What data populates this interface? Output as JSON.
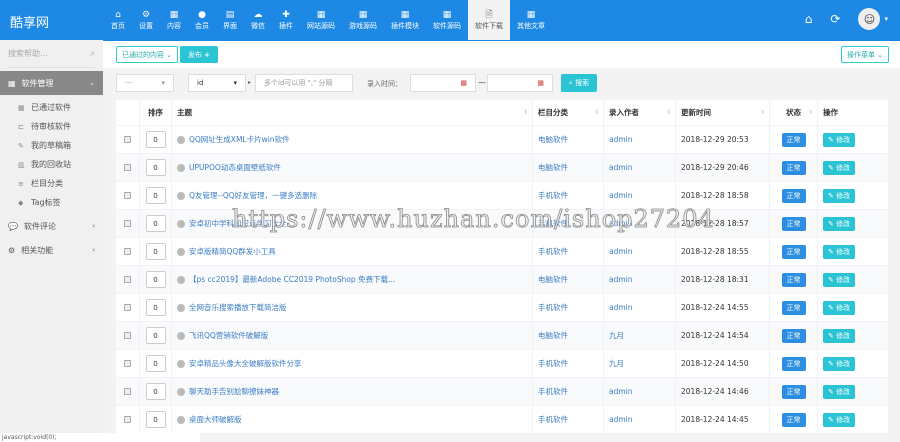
{
  "app": {
    "logo": "酷享网"
  },
  "nav": [
    {
      "label": "首页",
      "icon": "home-icon",
      "glyph": "⌂"
    },
    {
      "label": "设置",
      "icon": "gear-icon",
      "glyph": "⚙"
    },
    {
      "label": "内容",
      "icon": "grid-icon",
      "glyph": "▦"
    },
    {
      "label": "会员",
      "icon": "user-icon",
      "glyph": "●"
    },
    {
      "label": "界面",
      "icon": "layout-icon",
      "glyph": "▤"
    },
    {
      "label": "微信",
      "icon": "wechat-icon",
      "glyph": "☁"
    },
    {
      "label": "插件",
      "icon": "puzzle-icon",
      "glyph": "✚"
    },
    {
      "label": "网站源码",
      "icon": "table-icon",
      "glyph": "▦"
    },
    {
      "label": "游戏源码",
      "icon": "table-icon",
      "glyph": "▦"
    },
    {
      "label": "插件模块",
      "icon": "table-icon",
      "glyph": "▦"
    },
    {
      "label": "软件源码",
      "icon": "table-icon",
      "glyph": "▦"
    },
    {
      "label": "软件下载",
      "icon": "file-icon",
      "glyph": "🗎",
      "active": true
    },
    {
      "label": "其他文章",
      "icon": "table-icon",
      "glyph": "▦"
    }
  ],
  "sidebar": {
    "search_placeholder": "搜索帮助...",
    "group_main": "软件管理",
    "items": [
      {
        "label": "已通过软件",
        "icon": "grid-icon",
        "glyph": "▦"
      },
      {
        "label": "待审核软件",
        "icon": "ticket-icon",
        "glyph": "⊏"
      },
      {
        "label": "我的草稿箱",
        "icon": "edit-icon",
        "glyph": "✎"
      },
      {
        "label": "我的回收站",
        "icon": "trash-icon",
        "glyph": "▥"
      },
      {
        "label": "栏目分类",
        "icon": "list-icon",
        "glyph": "≡"
      },
      {
        "label": "Tag标签",
        "icon": "tag-icon",
        "glyph": "◆"
      }
    ],
    "group_comments": "软件评论",
    "group_related": "相关功能"
  },
  "toolbar": {
    "filter_dropdown": "已通过的内容",
    "publish": "发布",
    "batch": "操作菜单"
  },
  "search": {
    "select1": "---",
    "select2": "id",
    "ids_placeholder": "多个id可以用 \",\" 分隔",
    "time_label": "录入时间：",
    "dash": "—",
    "search_button": "搜索"
  },
  "table": {
    "headers": [
      "",
      "排序",
      "主题",
      "栏目分类",
      "录入作者",
      "更新时间",
      "状态",
      "操作"
    ],
    "status_label": "正常",
    "edit_label": "修改",
    "rows": [
      {
        "order": "0",
        "title": "QQ网址生成XML卡片win软件",
        "category": "电脑软件",
        "author": "admin",
        "time": "2018-12-29 20:53"
      },
      {
        "order": "0",
        "title": "UPUPOO动态桌面壁纸软件",
        "category": "电脑软件",
        "author": "admin",
        "time": "2018-12-29 20:46"
      },
      {
        "order": "0",
        "title": "Q友管理--QQ好友管理，一键多选删除",
        "category": "手机软件",
        "author": "admin",
        "time": "2018-12-28 18:58"
      },
      {
        "order": "0",
        "title": "安卓初中学科知识点学习大全",
        "category": "手机软件",
        "author": "admin",
        "time": "2018-12-28 18:57"
      },
      {
        "order": "0",
        "title": "安卓版精简QQ群发小工具",
        "category": "手机软件",
        "author": "admin",
        "time": "2018-12-28 18:55"
      },
      {
        "order": "0",
        "title": "【ps cc2019】最新Adobe CC2019 PhotoShop 免费下载...",
        "category": "电脑软件",
        "author": "admin",
        "time": "2018-12-28 18:31"
      },
      {
        "order": "0",
        "title": "全网音乐搜索播放下载简洁版",
        "category": "手机软件",
        "author": "admin",
        "time": "2018-12-24 14:55"
      },
      {
        "order": "0",
        "title": "飞讯QQ营销软件破解版",
        "category": "电脑软件",
        "author": "九月",
        "time": "2018-12-24 14:54"
      },
      {
        "order": "0",
        "title": "安卓精品头像大全破解版软件分享",
        "category": "手机软件",
        "author": "九月",
        "time": "2018-12-24 14:50"
      },
      {
        "order": "0",
        "title": "聊天助手告别尬聊撩妹神器",
        "category": "手机软件",
        "author": "admin",
        "time": "2018-12-24 14:46"
      },
      {
        "order": "0",
        "title": "桌面大师破解版",
        "category": "手机软件",
        "author": "admin",
        "time": "2018-12-24 14:45"
      }
    ]
  },
  "watermark": "https://www.huzhan.com/ishop27204",
  "statusbar": "javascript:void(0);",
  "colors": {
    "header": "#1e88e5",
    "accent": "#2bc4d4",
    "status": "#2b8ee0"
  }
}
